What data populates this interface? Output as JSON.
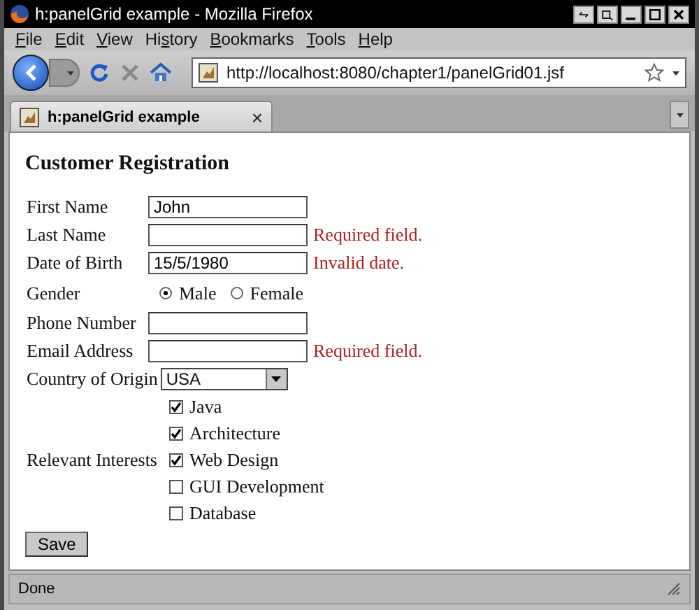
{
  "window": {
    "title": "h:panelGrid example - Mozilla Firefox"
  },
  "menu": [
    {
      "access_key": "F",
      "rest": "ile"
    },
    {
      "access_key": "E",
      "rest": "dit"
    },
    {
      "access_key": "V",
      "rest": "iew"
    },
    {
      "prefix": "Hi",
      "access_key": "s",
      "rest": "tory"
    },
    {
      "access_key": "B",
      "rest": "ookmarks"
    },
    {
      "access_key": "T",
      "rest": "ools"
    },
    {
      "access_key": "H",
      "rest": "elp"
    }
  ],
  "address": {
    "url": "http://localhost:8080/chapter1/panelGrid01.jsf"
  },
  "tabs": [
    {
      "title": "h:panelGrid example",
      "close": "×",
      "selected": true
    }
  ],
  "form": {
    "heading": "Customer Registration",
    "rows": [
      {
        "kind": "text",
        "label": "First Name",
        "value": "John"
      },
      {
        "kind": "text",
        "label": "Last Name",
        "error": "Required field."
      },
      {
        "kind": "text",
        "label": "Date of Birth",
        "value": "15/5/1980",
        "error": "Invalid date."
      },
      {
        "kind": "radio",
        "label": "Gender",
        "options": [
          {
            "label": "Male",
            "selected": true
          },
          {
            "label": "Female",
            "selected": false
          }
        ]
      },
      {
        "kind": "text",
        "label": "Phone Number"
      },
      {
        "kind": "text",
        "label": "Email Address",
        "error": "Required field."
      },
      {
        "kind": "select",
        "label": "Country of Origin",
        "value": "USA"
      },
      {
        "kind": "checkboxes",
        "label": "Relevant Interests",
        "options": [
          {
            "label": "Java",
            "checked": true
          },
          {
            "label": "Architecture",
            "checked": true
          },
          {
            "label": "Web Design",
            "checked": true
          },
          {
            "label": "GUI Development",
            "checked": false
          },
          {
            "label": "Database",
            "checked": false
          }
        ]
      }
    ],
    "submit": "Save"
  },
  "status_bar": {
    "text": "Done"
  }
}
